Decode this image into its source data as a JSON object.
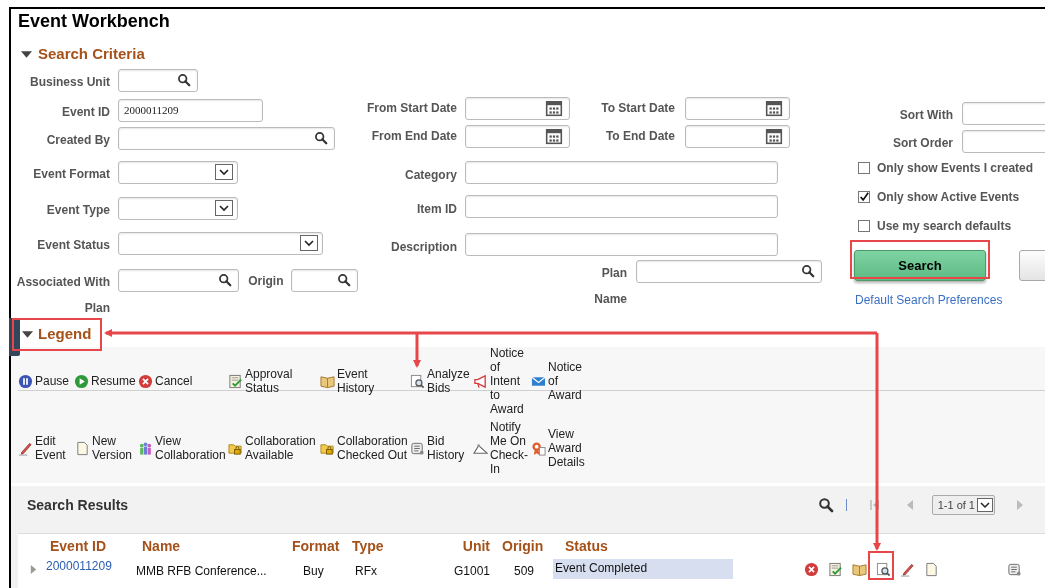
{
  "title": "Event Workbench",
  "search_criteria": {
    "title": "Search Criteria",
    "expanded": true,
    "left_fields": [
      {
        "label": "Business Unit",
        "kind": "lookup"
      },
      {
        "label": "Event ID",
        "kind": "text",
        "value": "2000011209"
      },
      {
        "label": "Created By",
        "kind": "lookup"
      },
      {
        "label": "Event Format",
        "kind": "select"
      },
      {
        "label": "Event Type",
        "kind": "select"
      },
      {
        "label": "Event Status",
        "kind": "select"
      },
      {
        "label": "Associated With",
        "kind": "lookup"
      }
    ],
    "origin": {
      "label": "Origin",
      "kind": "lookup"
    },
    "associated_plan_label": "Plan",
    "date_fields": [
      {
        "label": "From Start Date"
      },
      {
        "label": "To Start Date"
      },
      {
        "label": "From End Date"
      },
      {
        "label": "To End Date"
      }
    ],
    "middle_fields": [
      {
        "label": "Category"
      },
      {
        "label": "Item ID"
      },
      {
        "label": "Description"
      }
    ],
    "plan": {
      "label": "Plan",
      "sublabel": "Name"
    },
    "sort_fields": [
      {
        "label": "Sort With"
      },
      {
        "label": "Sort Order"
      }
    ],
    "options": [
      {
        "label": "Only show Events I created",
        "checked": false
      },
      {
        "label": "Only show Active Events",
        "checked": true
      },
      {
        "label": "Use my search defaults",
        "checked": false
      }
    ],
    "search_button": "Search",
    "preferences_link": "Default Search Preferences"
  },
  "legend": {
    "title": "Legend",
    "expanded": true,
    "rows": [
      {
        "items": [
          {
            "kind": "pause",
            "label": "Pause"
          },
          {
            "kind": "resume",
            "label": "Resume"
          },
          {
            "kind": "cancel",
            "label": "Cancel"
          },
          {
            "kind": "approval",
            "label": "Approval Status"
          },
          {
            "kind": "history",
            "label": "Event History"
          },
          {
            "kind": "analyze",
            "label": "Analyze Bids"
          },
          {
            "kind": "intent",
            "label": "Notice of Intent to Award"
          },
          {
            "kind": "notice",
            "label": "Notice of Award"
          }
        ]
      },
      {
        "items": [
          {
            "kind": "edit",
            "label": "Edit Event"
          },
          {
            "kind": "new_version",
            "label": "New Version"
          },
          {
            "kind": "collaboration",
            "label": "View Collaboration"
          },
          {
            "kind": "collab_available",
            "label": "Collaboration Available"
          },
          {
            "kind": "collab_checked_out",
            "label": "Collaboration Checked Out"
          },
          {
            "kind": "bid_history",
            "label": "Bid History"
          },
          {
            "kind": "notify",
            "label": "Notify Me On Check-In"
          },
          {
            "kind": "award_details",
            "label": "View Award Details"
          }
        ]
      }
    ]
  },
  "results": {
    "title": "Search Results",
    "pager": "1-1 of 1",
    "columns": [
      "Event ID",
      "Name",
      "Format",
      "Type",
      "Unit",
      "Origin",
      "Status"
    ],
    "rows": [
      {
        "expanded": false,
        "cells": [
          "2000011209",
          "MMB RFB Conference...",
          "Buy",
          "RFx",
          "G1001",
          "509",
          "Event Completed"
        ],
        "actions": [
          {
            "kind": "cancel"
          },
          {
            "kind": "approval"
          },
          {
            "kind": "history"
          },
          {
            "kind": "analyze"
          },
          {
            "kind": "edit"
          },
          {
            "kind": "new_version"
          },
          {
            "kind": "bid_history"
          }
        ]
      }
    ]
  }
}
